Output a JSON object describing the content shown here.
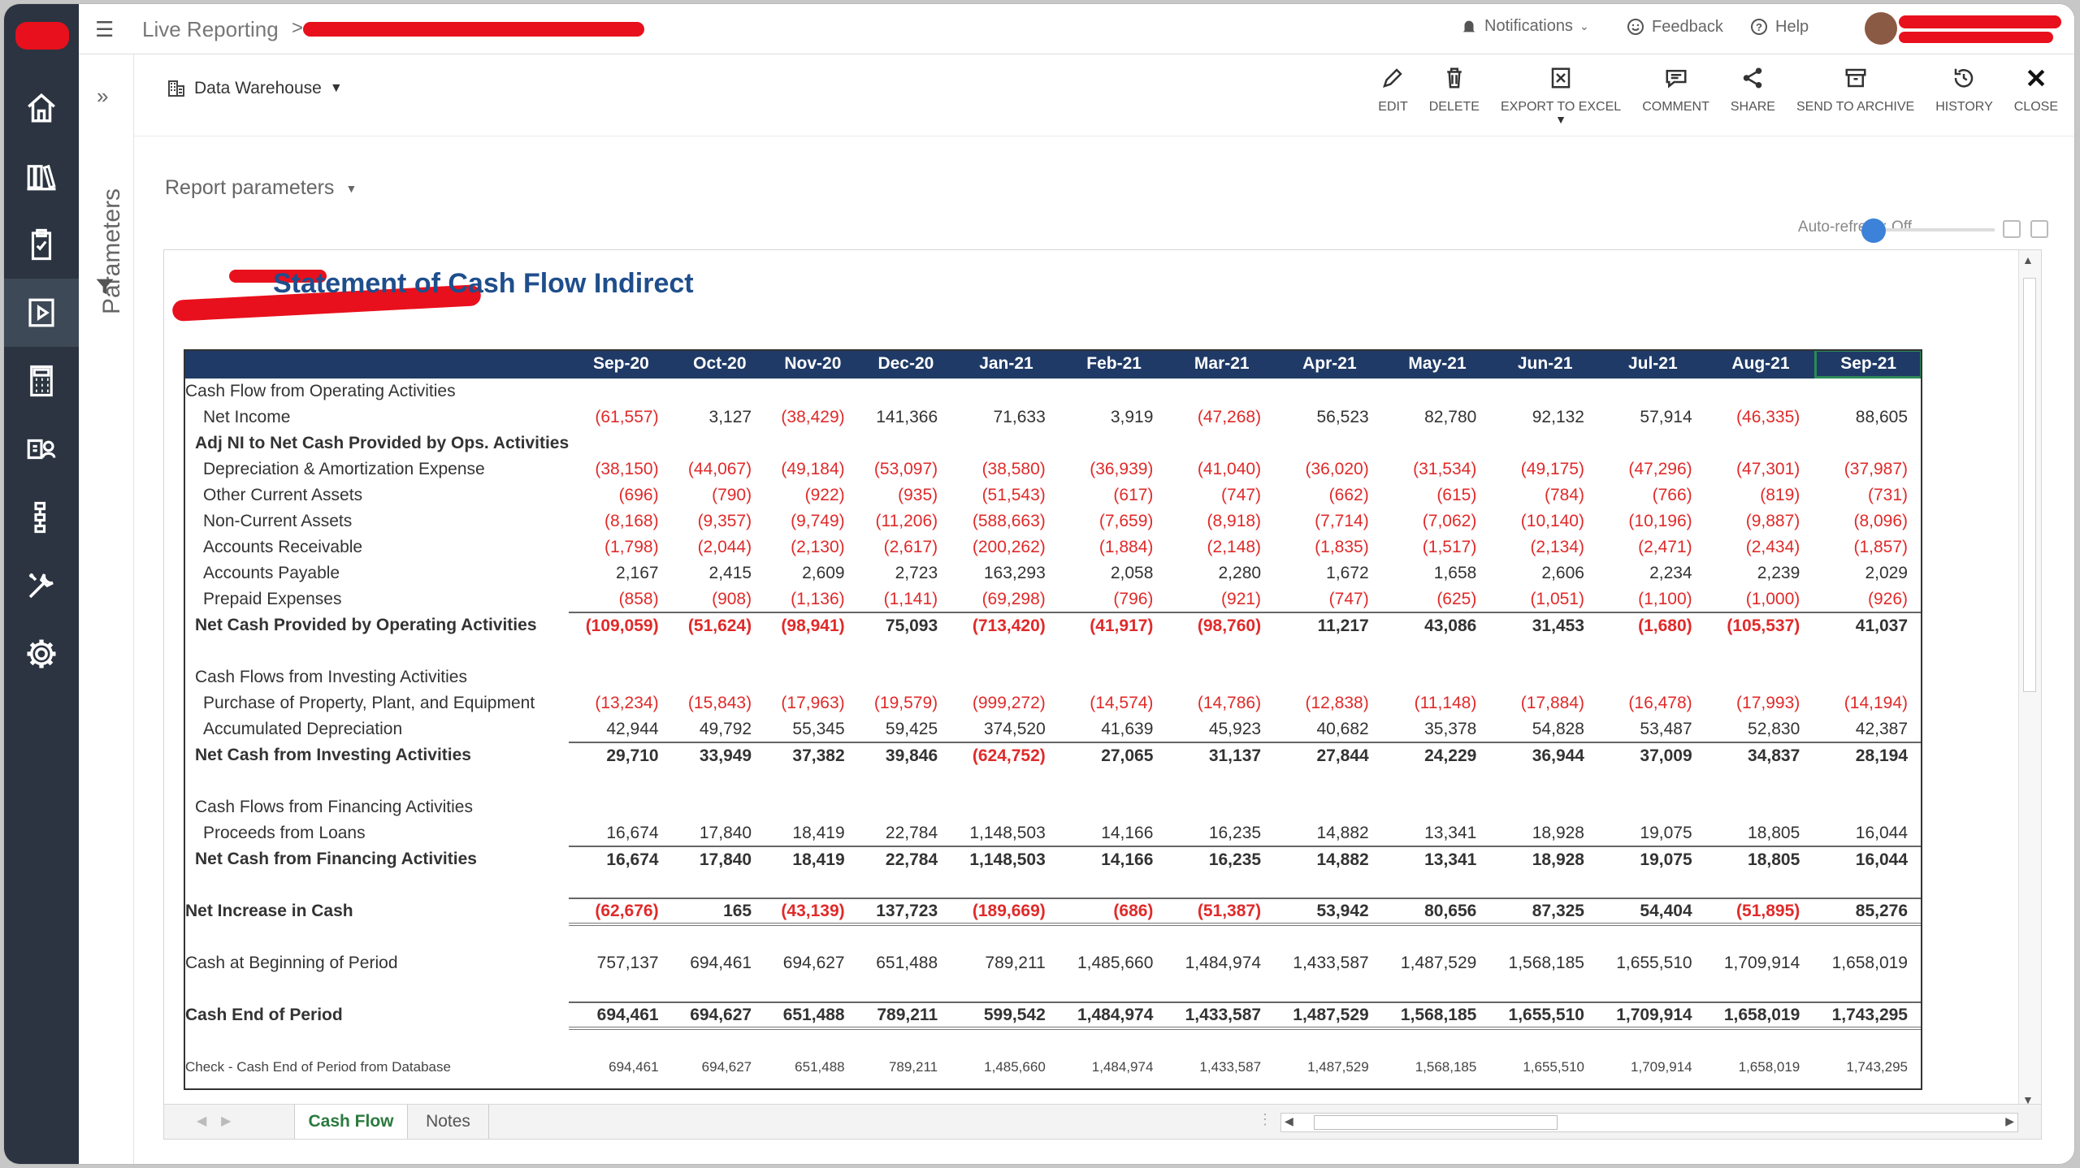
{
  "app": {
    "title": "Live Reporting",
    "crumb_separator": ">"
  },
  "top_right": {
    "notifications": "Notifications",
    "feedback": "Feedback",
    "help": "Help"
  },
  "sidebar": {
    "items": [
      "home-icon",
      "library-icon",
      "clipboard-icon",
      "report-icon",
      "calculator-icon",
      "user-card-icon",
      "hierarchy-icon",
      "tools-icon",
      "gear-icon"
    ]
  },
  "params": {
    "label": "Parameters"
  },
  "source": {
    "label": "Data Warehouse"
  },
  "toolbar": {
    "edit": "EDIT",
    "delete": "DELETE",
    "export": "EXPORT TO EXCEL",
    "comment": "COMMENT",
    "share": "SHARE",
    "archive": "SEND TO ARCHIVE",
    "history": "HISTORY",
    "close": "CLOSE"
  },
  "report_params": {
    "label": "Report parameters"
  },
  "auto_refresh": {
    "label": "Auto-refresh: Off"
  },
  "report": {
    "title": "Statement of Cash Flow Indirect",
    "months": [
      "Sep-20",
      "Oct-20",
      "Nov-20",
      "Dec-20",
      "Jan-21",
      "Feb-21",
      "Mar-21",
      "Apr-21",
      "May-21",
      "Jun-21",
      "Jul-21",
      "Aug-21",
      "Sep-21"
    ],
    "rows": [
      {
        "label": "Cash Flow from Operating Activities",
        "indent": 0,
        "style": "plain",
        "values": []
      },
      {
        "label": "Net Income",
        "indent": 2,
        "style": "plain",
        "values": [
          "(61,557)",
          "3,127",
          "(38,429)",
          "141,366",
          "71,633",
          "3,919",
          "(47,268)",
          "56,523",
          "82,780",
          "92,132",
          "57,914",
          "(46,335)",
          "88,605"
        ]
      },
      {
        "label": "Adj NI to Net Cash Provided by Ops. Activities",
        "indent": 1,
        "style": "bold",
        "values": []
      },
      {
        "label": "Depreciation & Amortization Expense",
        "indent": 2,
        "style": "plain",
        "values": [
          "(38,150)",
          "(44,067)",
          "(49,184)",
          "(53,097)",
          "(38,580)",
          "(36,939)",
          "(41,040)",
          "(36,020)",
          "(31,534)",
          "(49,175)",
          "(47,296)",
          "(47,301)",
          "(37,987)"
        ]
      },
      {
        "label": "Other Current Assets",
        "indent": 2,
        "style": "plain",
        "values": [
          "(696)",
          "(790)",
          "(922)",
          "(935)",
          "(51,543)",
          "(617)",
          "(747)",
          "(662)",
          "(615)",
          "(784)",
          "(766)",
          "(819)",
          "(731)"
        ]
      },
      {
        "label": "Non-Current Assets",
        "indent": 2,
        "style": "plain",
        "values": [
          "(8,168)",
          "(9,357)",
          "(9,749)",
          "(11,206)",
          "(588,663)",
          "(7,659)",
          "(8,918)",
          "(7,714)",
          "(7,062)",
          "(10,140)",
          "(10,196)",
          "(9,887)",
          "(8,096)"
        ]
      },
      {
        "label": "Accounts Receivable",
        "indent": 2,
        "style": "plain",
        "values": [
          "(1,798)",
          "(2,044)",
          "(2,130)",
          "(2,617)",
          "(200,262)",
          "(1,884)",
          "(2,148)",
          "(1,835)",
          "(1,517)",
          "(2,134)",
          "(2,471)",
          "(2,434)",
          "(1,857)"
        ]
      },
      {
        "label": "Accounts Payable",
        "indent": 2,
        "style": "plain",
        "values": [
          "2,167",
          "2,415",
          "2,609",
          "2,723",
          "163,293",
          "2,058",
          "2,280",
          "1,672",
          "1,658",
          "2,606",
          "2,234",
          "2,239",
          "2,029"
        ]
      },
      {
        "label": "Prepaid Expenses",
        "indent": 2,
        "style": "plain",
        "values": [
          "(858)",
          "(908)",
          "(1,136)",
          "(1,141)",
          "(69,298)",
          "(796)",
          "(921)",
          "(747)",
          "(625)",
          "(1,051)",
          "(1,100)",
          "(1,000)",
          "(926)"
        ]
      },
      {
        "label": "Net Cash Provided by Operating Activities",
        "indent": 1,
        "style": "bold-total",
        "values": [
          "(109,059)",
          "(51,624)",
          "(98,941)",
          "75,093",
          "(713,420)",
          "(41,917)",
          "(98,760)",
          "11,217",
          "43,086",
          "31,453",
          "(1,680)",
          "(105,537)",
          "41,037"
        ]
      },
      {
        "label": "",
        "indent": 0,
        "style": "spacer",
        "values": []
      },
      {
        "label": "Cash Flows from Investing Activities",
        "indent": 1,
        "style": "plain",
        "values": []
      },
      {
        "label": "Purchase of Property, Plant, and Equipment",
        "indent": 2,
        "style": "plain",
        "values": [
          "(13,234)",
          "(15,843)",
          "(17,963)",
          "(19,579)",
          "(999,272)",
          "(14,574)",
          "(14,786)",
          "(12,838)",
          "(11,148)",
          "(17,884)",
          "(16,478)",
          "(17,993)",
          "(14,194)"
        ]
      },
      {
        "label": "Accumulated Depreciation",
        "indent": 2,
        "style": "plain",
        "values": [
          "42,944",
          "49,792",
          "55,345",
          "59,425",
          "374,520",
          "41,639",
          "45,923",
          "40,682",
          "35,378",
          "54,828",
          "53,487",
          "52,830",
          "42,387"
        ]
      },
      {
        "label": "Net Cash from Investing Activities",
        "indent": 1,
        "style": "bold-total",
        "values": [
          "29,710",
          "33,949",
          "37,382",
          "39,846",
          "(624,752)",
          "27,065",
          "31,137",
          "27,844",
          "24,229",
          "36,944",
          "37,009",
          "34,837",
          "28,194"
        ]
      },
      {
        "label": "",
        "indent": 0,
        "style": "spacer",
        "values": []
      },
      {
        "label": "Cash Flows from Financing Activities",
        "indent": 1,
        "style": "plain",
        "values": []
      },
      {
        "label": "Proceeds from Loans",
        "indent": 2,
        "style": "plain",
        "values": [
          "16,674",
          "17,840",
          "18,419",
          "22,784",
          "1,148,503",
          "14,166",
          "16,235",
          "14,882",
          "13,341",
          "18,928",
          "19,075",
          "18,805",
          "16,044"
        ]
      },
      {
        "label": "Net Cash from Financing Activities",
        "indent": 1,
        "style": "bold-total",
        "values": [
          "16,674",
          "17,840",
          "18,419",
          "22,784",
          "1,148,503",
          "14,166",
          "16,235",
          "14,882",
          "13,341",
          "18,928",
          "19,075",
          "18,805",
          "16,044"
        ]
      },
      {
        "label": "",
        "indent": 0,
        "style": "spacer",
        "values": []
      },
      {
        "label": "Net Increase in Cash",
        "indent": 0,
        "style": "bold-boxed",
        "values": [
          "(62,676)",
          "165",
          "(43,139)",
          "137,723",
          "(189,669)",
          "(686)",
          "(51,387)",
          "53,942",
          "80,656",
          "87,325",
          "54,404",
          "(51,895)",
          "85,276"
        ]
      },
      {
        "label": "",
        "indent": 0,
        "style": "spacer",
        "values": []
      },
      {
        "label": "Cash at Beginning of Period",
        "indent": 0,
        "style": "plain",
        "values": [
          "757,137",
          "694,461",
          "694,627",
          "651,488",
          "789,211",
          "1,485,660",
          "1,484,974",
          "1,433,587",
          "1,487,529",
          "1,568,185",
          "1,655,510",
          "1,709,914",
          "1,658,019"
        ]
      },
      {
        "label": "",
        "indent": 0,
        "style": "spacer",
        "values": []
      },
      {
        "label": "Cash End of Period",
        "indent": 0,
        "style": "bold-boxed",
        "values": [
          "694,461",
          "694,627",
          "651,488",
          "789,211",
          "599,542",
          "1,484,974",
          "1,433,587",
          "1,487,529",
          "1,568,185",
          "1,655,510",
          "1,709,914",
          "1,658,019",
          "1,743,295"
        ]
      },
      {
        "label": "",
        "indent": 0,
        "style": "spacer",
        "values": []
      },
      {
        "label": "Check - Cash End of Period from Database",
        "indent": 0,
        "style": "small",
        "values": [
          "694,461",
          "694,627",
          "651,488",
          "789,211",
          "1,485,660",
          "1,484,974",
          "1,433,587",
          "1,487,529",
          "1,568,185",
          "1,655,510",
          "1,709,914",
          "1,658,019",
          "1,743,295"
        ]
      }
    ]
  },
  "tabs": [
    {
      "label": "Cash Flow",
      "active": true
    },
    {
      "label": "Notes",
      "active": false
    }
  ],
  "colors": {
    "sidebar": "#2b3440",
    "header_blue": "#1f3a66",
    "title_blue": "#1f4e8c",
    "negative": "#e02a2a",
    "active_tab": "#2b7a3e",
    "toggle": "#3b82d8"
  }
}
